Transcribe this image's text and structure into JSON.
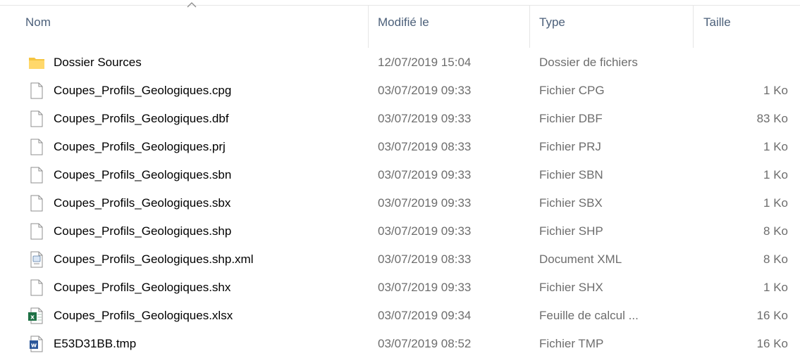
{
  "columns": {
    "name": "Nom",
    "modified": "Modifié le",
    "type": "Type",
    "size": "Taille"
  },
  "colors": {
    "header_text": "#4c607a",
    "folder": "#f5c542",
    "excel": "#1e7145",
    "word": "#2b579a"
  },
  "files": [
    {
      "name": "Dossier Sources",
      "modified": "12/07/2019 15:04",
      "type": "Dossier de fichiers",
      "size": "",
      "icon": "folder-icon"
    },
    {
      "name": "Coupes_Profils_Geologiques.cpg",
      "modified": "03/07/2019 09:33",
      "type": "Fichier CPG",
      "size": "1 Ko",
      "icon": "file-icon"
    },
    {
      "name": "Coupes_Profils_Geologiques.dbf",
      "modified": "03/07/2019 09:33",
      "type": "Fichier DBF",
      "size": "83 Ko",
      "icon": "file-icon"
    },
    {
      "name": "Coupes_Profils_Geologiques.prj",
      "modified": "03/07/2019 08:33",
      "type": "Fichier PRJ",
      "size": "1 Ko",
      "icon": "file-icon"
    },
    {
      "name": "Coupes_Profils_Geologiques.sbn",
      "modified": "03/07/2019 09:33",
      "type": "Fichier SBN",
      "size": "1 Ko",
      "icon": "file-icon"
    },
    {
      "name": "Coupes_Profils_Geologiques.sbx",
      "modified": "03/07/2019 09:33",
      "type": "Fichier SBX",
      "size": "1 Ko",
      "icon": "file-icon"
    },
    {
      "name": "Coupes_Profils_Geologiques.shp",
      "modified": "03/07/2019 09:33",
      "type": "Fichier SHP",
      "size": "8 Ko",
      "icon": "file-icon"
    },
    {
      "name": "Coupes_Profils_Geologiques.shp.xml",
      "modified": "03/07/2019 08:33",
      "type": "Document XML",
      "size": "8 Ko",
      "icon": "xml-file-icon"
    },
    {
      "name": "Coupes_Profils_Geologiques.shx",
      "modified": "03/07/2019 09:33",
      "type": "Fichier SHX",
      "size": "1 Ko",
      "icon": "file-icon"
    },
    {
      "name": "Coupes_Profils_Geologiques.xlsx",
      "modified": "03/07/2019 09:34",
      "type": "Feuille de calcul ...",
      "size": "16 Ko",
      "icon": "excel-file-icon"
    },
    {
      "name": "E53D31BB.tmp",
      "modified": "03/07/2019 08:52",
      "type": "Fichier TMP",
      "size": "16 Ko",
      "icon": "word-file-icon"
    }
  ]
}
